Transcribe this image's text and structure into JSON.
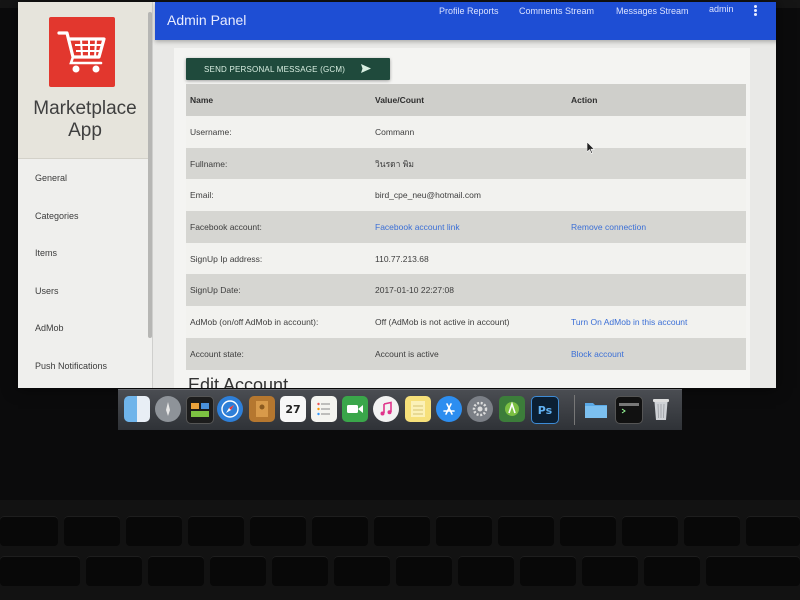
{
  "sidebar": {
    "brand_line1": "Marketplace",
    "brand_line2": "App",
    "logo_icon": "shopping-cart-icon",
    "items": [
      {
        "label": "General"
      },
      {
        "label": "Categories"
      },
      {
        "label": "Items"
      },
      {
        "label": "Users"
      },
      {
        "label": "AdMob"
      },
      {
        "label": "Push Notifications"
      }
    ]
  },
  "appbar": {
    "title": "Admin Panel",
    "links": [
      "Profile Reports",
      "Comments Stream",
      "Messages Stream",
      "admin"
    ],
    "more_icon": "more-vert-icon",
    "color": "#1e4ed4"
  },
  "actions": {
    "send_gcm_label": "SEND PERSONAL MESSAGE (GCM)",
    "send_icon": "send-icon"
  },
  "table": {
    "headers": [
      "Name",
      "Value/Count",
      "Action"
    ],
    "rows": [
      {
        "name": "Username:",
        "value": "Commann",
        "action": ""
      },
      {
        "name": "Fullname:",
        "value": "วินรดา พิม",
        "action": ""
      },
      {
        "name": "Email:",
        "value": "bird_cpe_neu@hotmail.com",
        "action": ""
      },
      {
        "name": "Facebook account:",
        "value": "Facebook account link",
        "action": "Remove connection"
      },
      {
        "name": "SignUp Ip address:",
        "value": "110.77.213.68",
        "action": ""
      },
      {
        "name": "SignUp Date:",
        "value": "2017-01-10 22:27:08",
        "action": ""
      },
      {
        "name": "AdMob (on/off AdMob in account):",
        "value": "Off (AdMob is not active in account)",
        "action": "Turn On AdMob in this account"
      },
      {
        "name": "Account state:",
        "value": "Account is active",
        "action": "Block account"
      }
    ]
  },
  "edit_heading": "Edit Account",
  "dock": {
    "apps": [
      "finder-icon",
      "launchpad-icon",
      "mission-control-icon",
      "safari-icon",
      "contacts-icon",
      "calendar-icon",
      "reminders-icon",
      "facetime-icon",
      "itunes-icon",
      "notes-icon",
      "app-store-icon",
      "system-preferences-icon",
      "android-studio-icon",
      "photoshop-icon",
      "downloads-folder-icon",
      "terminal-icon",
      "trash-icon"
    ],
    "calendar_day": "27",
    "photoshop_label": "Ps"
  }
}
